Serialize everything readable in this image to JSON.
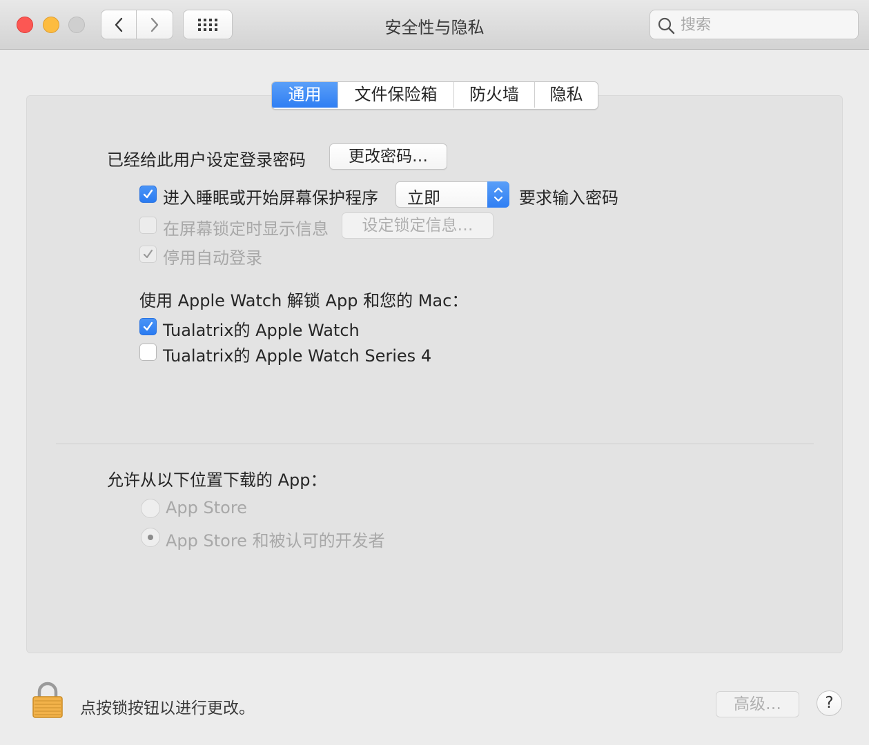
{
  "window": {
    "title": "安全性与隐私"
  },
  "toolbar": {
    "back_icon": "chevron-left-icon",
    "forward_icon": "chevron-right-icon",
    "grid_icon": "show-all-grid-icon",
    "search_placeholder": "搜索"
  },
  "tabs": [
    {
      "label": "通用",
      "active": true
    },
    {
      "label": "文件保险箱",
      "active": false
    },
    {
      "label": "防火墙",
      "active": false
    },
    {
      "label": "隐私",
      "active": false
    }
  ],
  "general": {
    "password_label": "已经给此用户设定登录密码",
    "change_password_button": "更改密码…",
    "require_password": {
      "checked": true,
      "label": "进入睡眠或开始屏幕保护程序",
      "delay_value": "立即",
      "suffix": "要求输入密码"
    },
    "show_message": {
      "checked": false,
      "enabled": false,
      "label": "在屏幕锁定时显示信息",
      "button": "设定锁定信息…"
    },
    "disable_auto_login": {
      "checked": true,
      "enabled": false,
      "label": "停用自动登录"
    },
    "apple_watch": {
      "heading": "使用 Apple Watch 解锁 App 和您的 Mac：",
      "devices": [
        {
          "label": "Tualatrix的 Apple Watch",
          "checked": true
        },
        {
          "label": "Tualatrix的 Apple Watch Series 4",
          "checked": false
        }
      ]
    },
    "downloads": {
      "heading": "允许从以下位置下载的 App：",
      "options": [
        {
          "label": "App Store",
          "selected": false
        },
        {
          "label": "App Store 和被认可的开发者",
          "selected": true
        }
      ]
    }
  },
  "footer": {
    "lock_icon": "padlock-icon",
    "lock_text": "点按锁按钮以进行更改。",
    "advanced_button": "高级…",
    "help_button": "?"
  },
  "colors": {
    "accent": "#2f7ef3",
    "close": "#fc5753",
    "minimize": "#fdbc40",
    "zoom_disabled": "#cfcfcf"
  }
}
